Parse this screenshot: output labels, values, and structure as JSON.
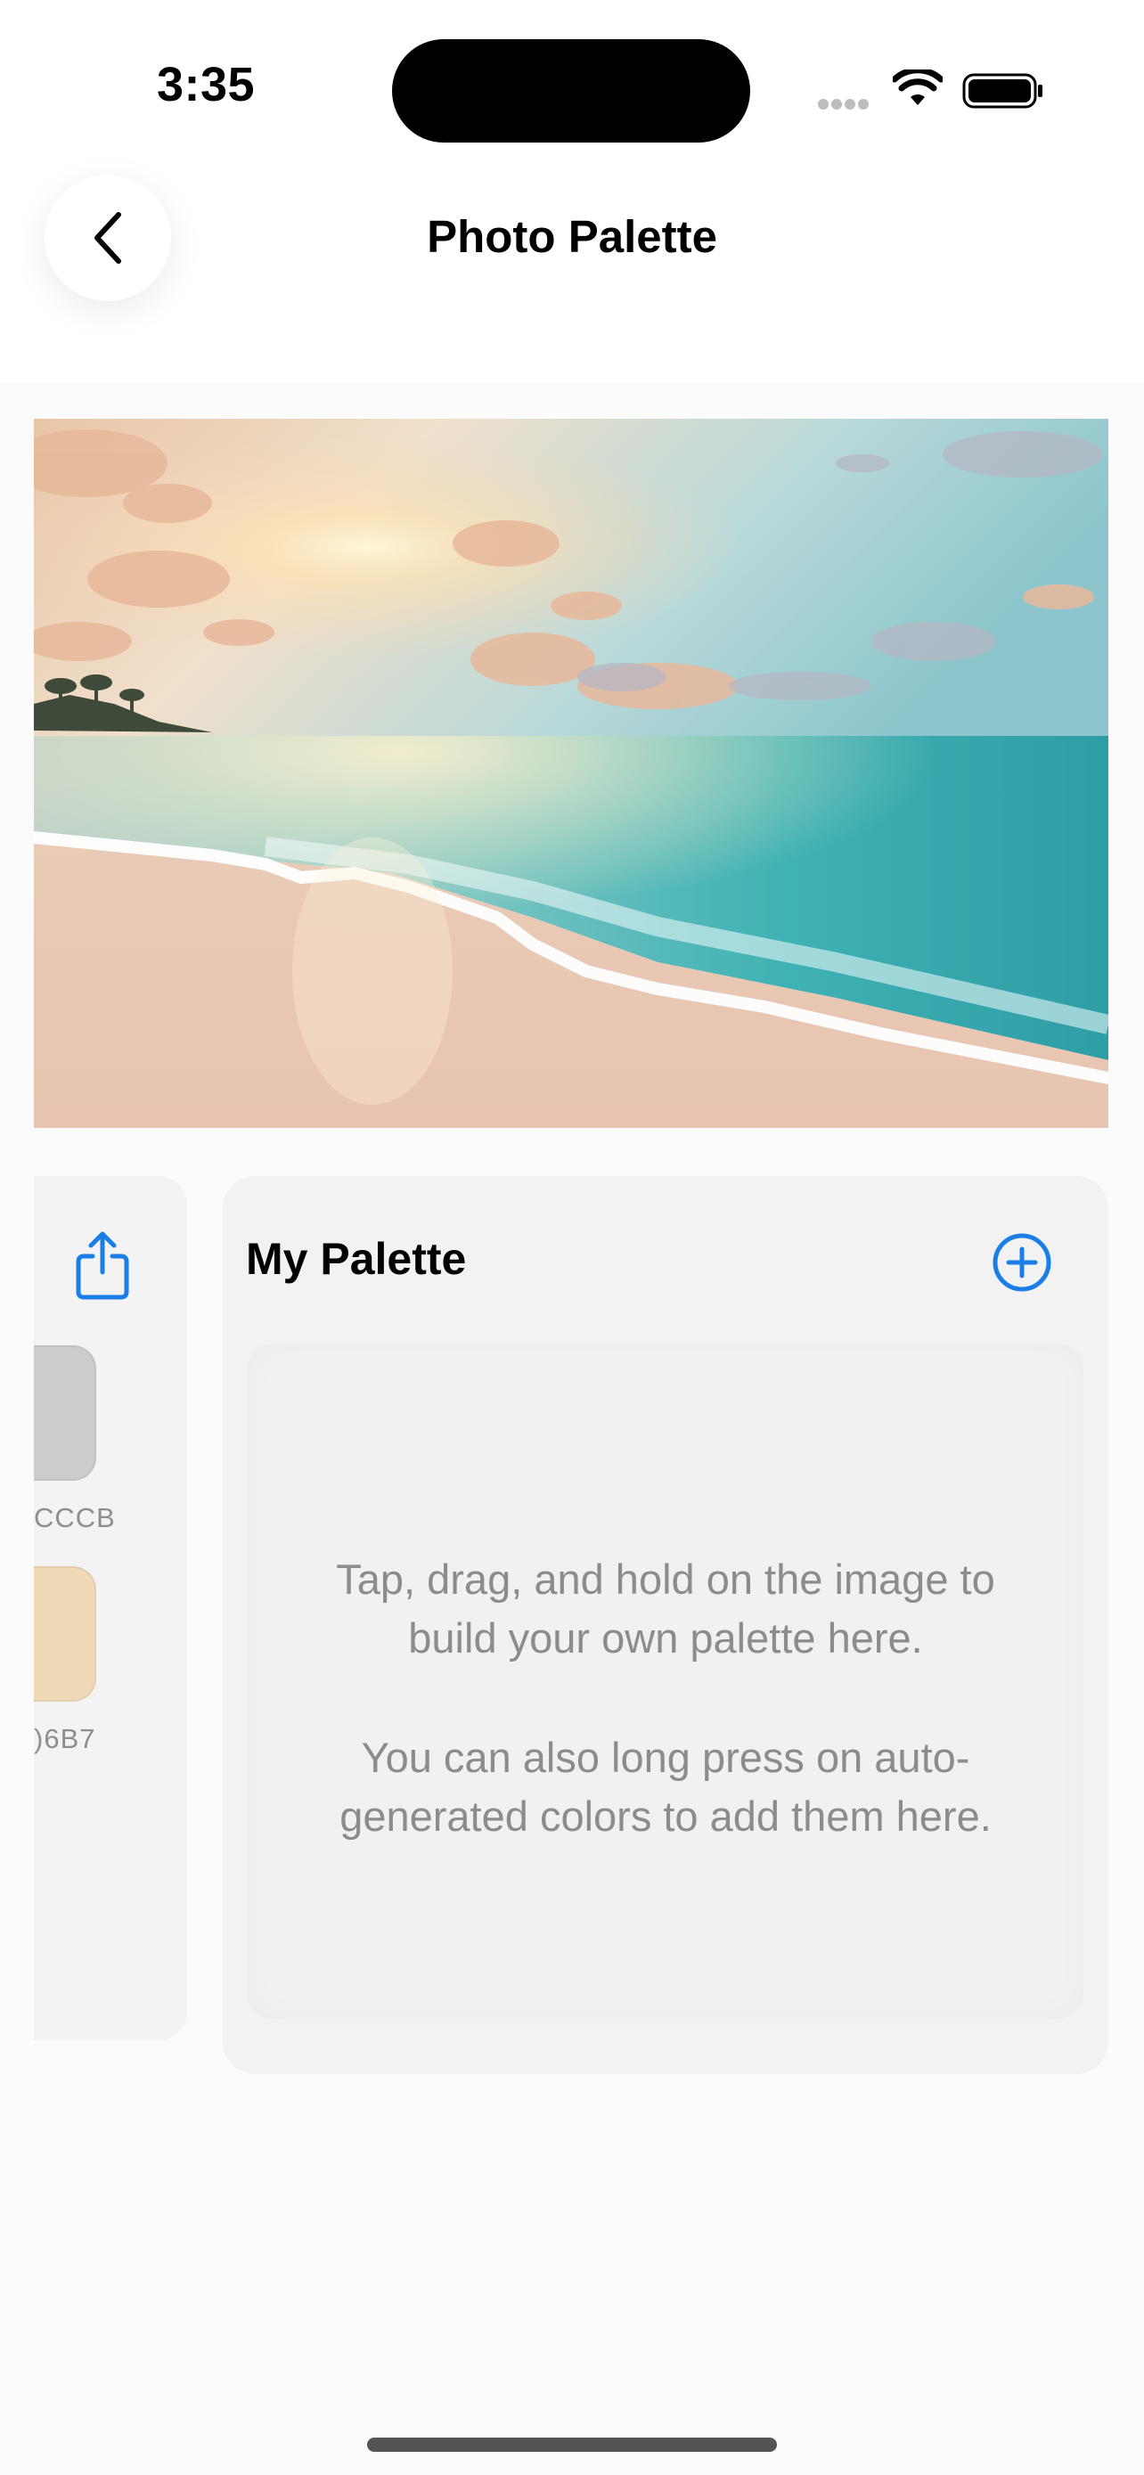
{
  "status_bar": {
    "time": "3:35"
  },
  "nav": {
    "title": "Photo Palette",
    "back_icon": "chevron-left-icon"
  },
  "photo": {
    "subject": "beach-sunset-photo"
  },
  "auto_palette": {
    "share_icon": "share-icon",
    "swatches": [
      {
        "hex_visible": "CCCB",
        "color": "#cccccb"
      },
      {
        "hex_visible": ")6B7",
        "color": "#efd9b7"
      }
    ]
  },
  "my_palette": {
    "title": "My Palette",
    "add_icon": "plus-circle-icon",
    "hint_line_1": "Tap, drag, and hold on the image to build your own palette here.",
    "hint_line_2": "You can also long press on auto-generated colors to add them here."
  },
  "colors": {
    "accent": "#1a7ee6",
    "card_bg": "#f2f2f2",
    "hint_text": "#8c8c8c"
  }
}
